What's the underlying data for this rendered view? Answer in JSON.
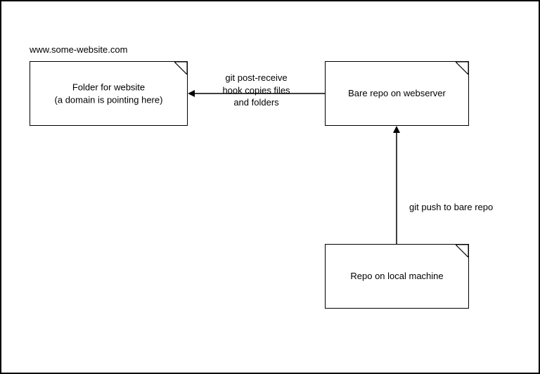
{
  "domain_label": "www.some-website.com",
  "boxes": {
    "website_folder": {
      "line1": "Folder for website",
      "line2": "(a domain is pointing here)"
    },
    "bare_repo": "Bare repo on webserver",
    "local_repo": "Repo on local machine"
  },
  "arrows": {
    "post_receive": {
      "line1": "git post-receive",
      "line2": "hook copies files",
      "line3": "and folders"
    },
    "push": "git push to bare repo"
  }
}
